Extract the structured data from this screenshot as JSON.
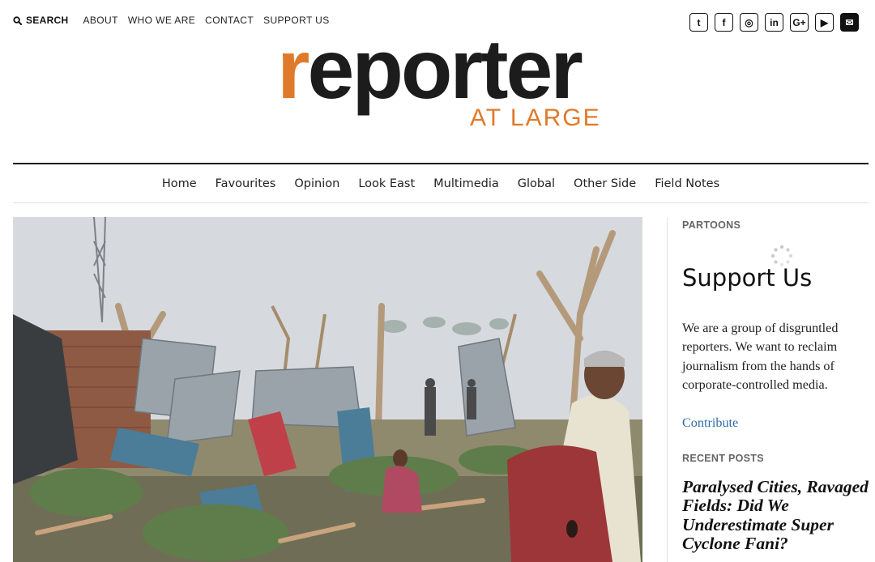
{
  "topbar": {
    "search_label": "SEARCH",
    "links": [
      "ABOUT",
      "WHO WE ARE",
      "CONTACT",
      "SUPPORT US"
    ]
  },
  "social": [
    {
      "icon": "twitter-icon",
      "glyph": "t"
    },
    {
      "icon": "facebook-icon",
      "glyph": "f"
    },
    {
      "icon": "instagram-icon",
      "glyph": "◎"
    },
    {
      "icon": "linkedin-icon",
      "glyph": "in"
    },
    {
      "icon": "google-plus-icon",
      "glyph": "G+"
    },
    {
      "icon": "youtube-icon",
      "glyph": "▶"
    },
    {
      "icon": "email-icon",
      "glyph": "✉"
    }
  ],
  "logo": {
    "accent": "r",
    "rest": "eporter",
    "subtitle": "AT LARGE",
    "accent_color": "#e07a2b"
  },
  "nav": [
    "Home",
    "Favourites",
    "Opinion",
    "Look East",
    "Multimedia",
    "Global",
    "Other Side",
    "Field Notes"
  ],
  "sidebar": {
    "partoons_heading": "PARTOONS",
    "support_title": "Support Us",
    "support_text": "We are a group of disgruntled reporters. We want to reclaim journalism from the hands of corporate-controlled media.",
    "contribute_label": "Contribute",
    "recent_heading": "RECENT POSTS",
    "recent_post_title": "Paralysed Cities, Ravaged Fields: Did We Underestimate Super Cyclone Fani?"
  },
  "colors": {
    "link": "#2d6ca7",
    "text": "#222222"
  }
}
